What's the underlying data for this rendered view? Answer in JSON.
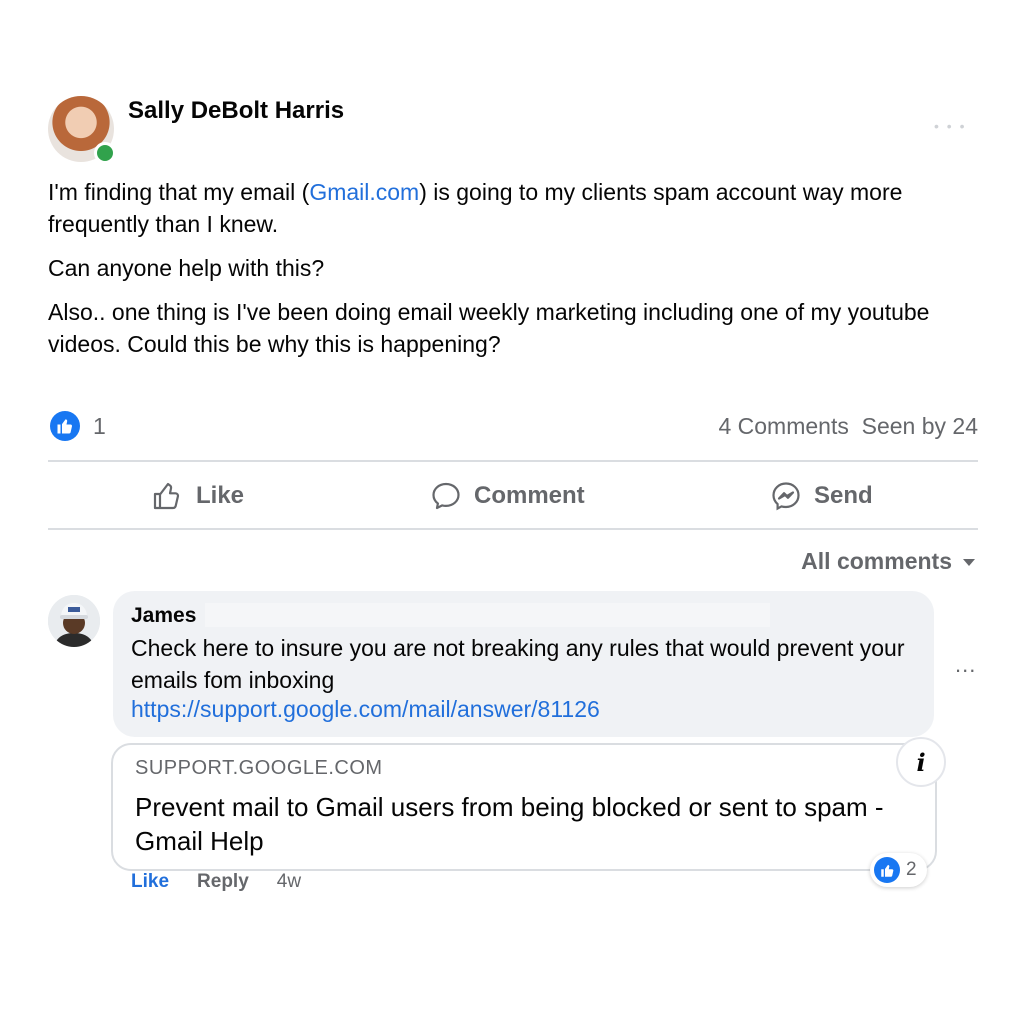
{
  "post": {
    "author": "Sally DeBolt Harris",
    "menu_icon": "more-icon",
    "paragraph1_before": "I'm finding that my email (",
    "paragraph1_link": "Gmail.com",
    "paragraph1_after": ") is going to my clients spam account way more frequently than I knew.",
    "paragraph2": "Can anyone help with this?",
    "paragraph3": "Also.. one thing is I've been doing email weekly marketing including one of my youtube videos. Could this be why this is happening?",
    "reaction_count": "1",
    "comments_count": "4 Comments",
    "seen_by": "Seen by 24"
  },
  "actions": {
    "like": "Like",
    "comment": "Comment",
    "send": "Send"
  },
  "comments_filter": "All comments",
  "comment": {
    "author": "James",
    "text": "Check here to insure you are not breaking any rules that would prevent your emails fom inboxing",
    "link": "https://support.google.com/mail/answer/81126",
    "preview": {
      "domain": "SUPPORT.GOOGLE.COM",
      "title": "Prevent mail to Gmail users from being blocked or sent to spam - Gmail Help",
      "info": "i"
    },
    "like_label": "Like",
    "reply_label": "Reply",
    "time": "4w",
    "reaction_count": "2",
    "menu": "..."
  },
  "colors": {
    "accent": "#1877f2",
    "link": "#216fdb",
    "secondary_text": "#65676b",
    "online": "#31a24c"
  }
}
